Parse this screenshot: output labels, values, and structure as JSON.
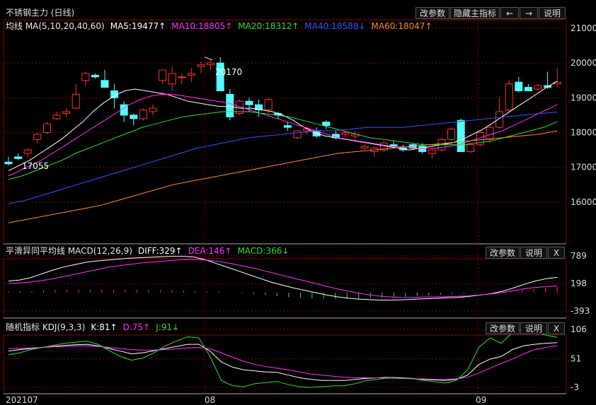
{
  "app": {
    "title": "不锈钢主力 (日线)",
    "buttons": {
      "params": "改参数",
      "hide": "隐藏主指标",
      "left_icon": "arrow-left",
      "right_icon": "arrow-right",
      "help": "说明",
      "close": "X"
    }
  },
  "main_legend": [
    {
      "text": "均线 MA(5,10,20,40,60)",
      "color": "#e8e8e8"
    },
    {
      "text": "MA5:19477↑",
      "color": "#ffffff"
    },
    {
      "text": "MA10:18805↑",
      "color": "#ff33ff"
    },
    {
      "text": "MA20:18312↑",
      "color": "#33dd33"
    },
    {
      "text": "MA40:18588↓",
      "color": "#3355ff"
    },
    {
      "text": "MA60:18047↑",
      "color": "#ff8833"
    }
  ],
  "macd_legend": [
    {
      "text": "平滑异同平均线 MACD(12,26,9)",
      "color": "#e8e8e8"
    },
    {
      "text": "DIFF:329↑",
      "color": "#ffffff"
    },
    {
      "text": "DEA:146↑",
      "color": "#ff33ff"
    },
    {
      "text": "MACD:366↓",
      "color": "#33dd33"
    }
  ],
  "kdj_legend": [
    {
      "text": "随机指标 KDJ(9,3,3)",
      "color": "#e8e8e8"
    },
    {
      "text": "K:81↑",
      "color": "#ffffff"
    },
    {
      "text": "D:75↑",
      "color": "#ff33ff"
    },
    {
      "text": "J:91↓",
      "color": "#33dd33"
    }
  ],
  "annotations": {
    "high": "20170",
    "low": "17055"
  },
  "colors": {
    "up": "#ff3232",
    "down": "#54ffff",
    "grid": "#8b0000"
  },
  "chart_data": [
    {
      "type": "candlestick",
      "title": "不锈钢主力 (日线)",
      "ylim": [
        15000,
        21000
      ],
      "y_ticks": [
        16000,
        17000,
        18000,
        19000,
        20000,
        21000
      ],
      "x_ticks": [
        "202107",
        "08",
        "09"
      ],
      "candles": [
        [
          17150,
          17300,
          17050,
          17100
        ],
        [
          17300,
          17400,
          17200,
          17250
        ],
        [
          17400,
          17550,
          17300,
          17500
        ],
        [
          17800,
          18000,
          17700,
          17950
        ],
        [
          18000,
          18300,
          17950,
          18250
        ],
        [
          18400,
          18600,
          18350,
          18500
        ],
        [
          18550,
          18700,
          18450,
          18600
        ],
        [
          18700,
          19400,
          18650,
          19100
        ],
        [
          19500,
          19750,
          19350,
          19700
        ],
        [
          19650,
          19700,
          19550,
          19600
        ],
        [
          19500,
          19800,
          19450,
          19300
        ],
        [
          19200,
          19400,
          18700,
          19000
        ],
        [
          18800,
          18900,
          18300,
          18500
        ],
        [
          18500,
          18550,
          18200,
          18400
        ],
        [
          18400,
          18700,
          18350,
          18650
        ],
        [
          18600,
          18800,
          18500,
          18700
        ],
        [
          19500,
          19800,
          19400,
          19800
        ],
        [
          19400,
          19900,
          19200,
          19700
        ],
        [
          19600,
          19700,
          19400,
          19600
        ],
        [
          19650,
          19850,
          19450,
          19700
        ],
        [
          19900,
          20050,
          19700,
          19950
        ],
        [
          19950,
          20080,
          19800,
          20000
        ],
        [
          20000,
          20170,
          19900,
          19200
        ],
        [
          19100,
          19250,
          18350,
          18450
        ],
        [
          18550,
          18950,
          18500,
          18900
        ],
        [
          18900,
          19000,
          18600,
          18800
        ],
        [
          18800,
          18950,
          18450,
          18650
        ],
        [
          18650,
          19000,
          18550,
          18950
        ],
        [
          18550,
          18600,
          18400,
          18500
        ],
        [
          18200,
          18300,
          18050,
          18150
        ],
        [
          17850,
          18050,
          17800,
          18050
        ],
        [
          18050,
          18200,
          17950,
          18100
        ],
        [
          18050,
          18150,
          17850,
          17900
        ],
        [
          18300,
          18350,
          18100,
          18200
        ],
        [
          17950,
          18050,
          17800,
          17850
        ],
        [
          17950,
          18050,
          17850,
          18000
        ],
        [
          17900,
          18050,
          17800,
          17950
        ],
        [
          17550,
          17650,
          17500,
          17600
        ],
        [
          17450,
          17600,
          17300,
          17550
        ],
        [
          17500,
          17750,
          17450,
          17700
        ],
        [
          17650,
          17750,
          17550,
          17600
        ],
        [
          17550,
          17650,
          17450,
          17500
        ],
        [
          17650,
          17700,
          17500,
          17550
        ],
        [
          17600,
          17700,
          17400,
          17450
        ],
        [
          17400,
          17550,
          17250,
          17500
        ],
        [
          17500,
          17850,
          17450,
          17800
        ],
        [
          17800,
          18150,
          17750,
          18100
        ],
        [
          18350,
          18400,
          17800,
          17450
        ],
        [
          17450,
          17700,
          17400,
          17650
        ],
        [
          17650,
          18050,
          17600,
          18000
        ],
        [
          17800,
          18200,
          17700,
          18150
        ],
        [
          18150,
          19000,
          18100,
          18600
        ],
        [
          18650,
          19500,
          18600,
          19400
        ],
        [
          19450,
          19600,
          19150,
          19200
        ],
        [
          19300,
          19400,
          19250,
          19200
        ],
        [
          19250,
          19400,
          19200,
          19350
        ],
        [
          19350,
          19750,
          19250,
          19300
        ],
        [
          19400,
          19850,
          19300,
          19450
        ]
      ],
      "series": [
        {
          "name": "MA5",
          "color": "#ffffff",
          "values": [
            16900,
            17050,
            17200,
            17400,
            17600,
            17800,
            18050,
            18300,
            18600,
            18850,
            19050,
            19200,
            19250,
            19200,
            19150,
            19100,
            19000,
            18900,
            18850,
            18800,
            18750,
            18750,
            18700,
            18700,
            18650,
            18600,
            18500,
            18350,
            18150,
            18000,
            17900,
            17850,
            17800,
            17750,
            17700,
            17650,
            17600,
            17550,
            17500,
            17550,
            17600,
            17650,
            17700,
            17800,
            17950,
            18100,
            18300,
            18500,
            18700,
            18900,
            19100,
            19300,
            19477
          ]
        },
        {
          "name": "MA10",
          "color": "#ff33ff",
          "values": [
            16750,
            16900,
            17050,
            17200,
            17400,
            17600,
            17800,
            18000,
            18200,
            18400,
            18600,
            18800,
            18950,
            19050,
            19100,
            19100,
            19050,
            19000,
            18950,
            18900,
            18850,
            18750,
            18650,
            18550,
            18450,
            18350,
            18250,
            18150,
            18050,
            17950,
            17850,
            17800,
            17750,
            17700,
            17650,
            17600,
            17600,
            17550,
            17550,
            17550,
            17600,
            17650,
            17750,
            17850,
            17950,
            18050,
            18200,
            18350,
            18500,
            18650,
            18805
          ]
        },
        {
          "name": "MA20",
          "color": "#33dd33",
          "values": [
            16650,
            16750,
            16900,
            17050,
            17200,
            17400,
            17550,
            17700,
            17850,
            18000,
            18150,
            18250,
            18350,
            18450,
            18500,
            18550,
            18600,
            18600,
            18600,
            18550,
            18500,
            18450,
            18350,
            18250,
            18150,
            18050,
            17950,
            17850,
            17800,
            17750,
            17700,
            17650,
            17650,
            17650,
            17650,
            17700,
            17750,
            17850,
            17950,
            18050,
            18150,
            18312
          ]
        },
        {
          "name": "MA40",
          "color": "#3355ff",
          "values": [
            15950,
            16050,
            16200,
            16350,
            16500,
            16650,
            16800,
            16950,
            17100,
            17250,
            17400,
            17550,
            17650,
            17750,
            17850,
            17900,
            17950,
            18000,
            18050,
            18050,
            18100,
            18150,
            18150,
            18150,
            18200,
            18250,
            18300,
            18350,
            18400,
            18450,
            18500,
            18550,
            18588
          ]
        },
        {
          "name": "MA60",
          "color": "#ff8833",
          "values": [
            15400,
            15500,
            15600,
            15700,
            15800,
            15900,
            16050,
            16200,
            16350,
            16500,
            16600,
            16700,
            16800,
            16900,
            17000,
            17100,
            17200,
            17300,
            17400,
            17450,
            17500,
            17550,
            17600,
            17650,
            17700,
            17750,
            17800,
            17850,
            17900,
            17950,
            18047
          ]
        }
      ]
    },
    {
      "type": "line",
      "title": "平滑异同平均线 MACD(12,26,9)",
      "ylim": [
        -393,
        789
      ],
      "y_ticks": [
        789,
        198,
        -393
      ],
      "series": [
        {
          "name": "DIFF",
          "color": "#ffffff",
          "values": [
            250,
            270,
            320,
            400,
            480,
            550,
            600,
            650,
            680,
            700,
            720,
            740,
            750,
            760,
            770,
            780,
            780,
            760,
            700,
            620,
            540,
            460,
            380,
            300,
            220,
            160,
            100,
            50,
            0,
            -50,
            -90,
            -120,
            -140,
            -150,
            -160,
            -160,
            -150,
            -140,
            -130,
            -120,
            -110,
            -100,
            -80,
            -50,
            -20,
            30,
            100,
            180,
            250,
            300,
            329
          ]
        },
        {
          "name": "DEA",
          "color": "#ff33ff",
          "values": [
            200,
            210,
            230,
            260,
            300,
            350,
            400,
            450,
            500,
            550,
            580,
            610,
            640,
            660,
            680,
            700,
            710,
            710,
            690,
            660,
            620,
            570,
            520,
            460,
            400,
            340,
            280,
            220,
            160,
            100,
            50,
            0,
            -40,
            -70,
            -90,
            -100,
            -100,
            -95,
            -90,
            -85,
            -80,
            -70,
            -50,
            -30,
            0,
            40,
            80,
            110,
            130,
            146
          ]
        },
        {
          "name": "MACD",
          "color": "#33dd33",
          "values": [
            80,
            90,
            110,
            140,
            170,
            190,
            200,
            200,
            200,
            200,
            190,
            180,
            170,
            160,
            150,
            130,
            110,
            90,
            60,
            20,
            -40,
            -90,
            -150,
            -220,
            -280,
            -330,
            -360,
            -380,
            -390,
            -380,
            -360,
            -330,
            -300,
            -270,
            -240,
            -200,
            -160,
            -120,
            -90,
            -60,
            -30,
            0,
            60,
            120,
            180,
            240,
            300,
            366
          ]
        }
      ]
    },
    {
      "type": "line",
      "title": "随机指标 KDJ(9,3,3)",
      "ylim": [
        -3,
        106
      ],
      "y_ticks": [
        106,
        51,
        -3
      ],
      "series": [
        {
          "name": "K",
          "color": "#ffffff",
          "values": [
            65,
            68,
            70,
            72,
            74,
            76,
            77,
            78,
            75,
            70,
            65,
            60,
            62,
            66,
            70,
            74,
            78,
            78,
            65,
            45,
            35,
            30,
            28,
            26,
            25,
            20,
            15,
            12,
            10,
            10,
            10,
            12,
            14,
            15,
            16,
            15,
            14,
            12,
            11,
            10,
            12,
            20,
            40,
            50,
            55,
            68,
            75,
            78,
            80,
            81
          ]
        },
        {
          "name": "D",
          "color": "#ff33ff",
          "values": [
            70,
            70,
            71,
            72,
            73,
            74,
            75,
            75,
            74,
            72,
            70,
            68,
            67,
            67,
            68,
            69,
            71,
            72,
            70,
            62,
            54,
            46,
            40,
            36,
            33,
            30,
            26,
            22,
            20,
            18,
            16,
            15,
            15,
            15,
            14,
            14,
            13,
            13,
            12,
            12,
            13,
            16,
            24,
            33,
            42,
            50,
            60,
            68,
            72,
            75
          ]
        },
        {
          "name": "J",
          "color": "#33dd33",
          "values": [
            58,
            62,
            68,
            72,
            76,
            80,
            82,
            84,
            78,
            66,
            55,
            48,
            52,
            62,
            75,
            84,
            92,
            90,
            55,
            10,
            0,
            -2,
            4,
            6,
            8,
            2,
            -2,
            -3,
            -2,
            0,
            0,
            4,
            10,
            12,
            16,
            14,
            14,
            10,
            8,
            5,
            10,
            30,
            72,
            90,
            80,
            100,
            106,
            100,
            95,
            91
          ]
        }
      ]
    }
  ]
}
